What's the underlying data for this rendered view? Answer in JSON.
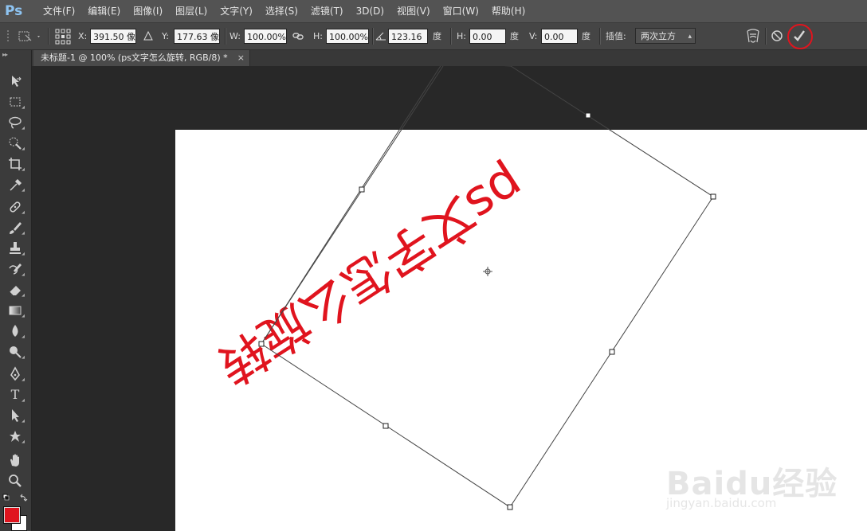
{
  "app": {
    "logo": "Ps"
  },
  "menu": [
    "文件(F)",
    "编辑(E)",
    "图像(I)",
    "图层(L)",
    "文字(Y)",
    "选择(S)",
    "滤镜(T)",
    "3D(D)",
    "视图(V)",
    "窗口(W)",
    "帮助(H)"
  ],
  "options": {
    "x_label": "X:",
    "x_value": "391.50 像",
    "y_label": "Y:",
    "y_value": "177.63 像",
    "w_label": "W:",
    "w_value": "100.00%",
    "h_label": "H:",
    "h_value": "100.00%",
    "angle_value": "123.16",
    "angle_unit": "度",
    "hskew_label": "H:",
    "hskew_value": "0.00",
    "hskew_unit": "度",
    "vskew_label": "V:",
    "vskew_value": "0.00",
    "vskew_unit": "度",
    "interp_label": "插值:",
    "interp_value": "两次立方"
  },
  "document": {
    "tab_title": "未标题-1 @ 100% (ps文字怎么旋转, RGB/8) *",
    "close_glyph": "×"
  },
  "canvas": {
    "text": "ps文字怎么旋转",
    "text_color": "#e0141e",
    "rotation_degrees": 123.16
  },
  "colors": {
    "foreground": "#e0141e",
    "background": "#ffffff",
    "confirm_highlight": "#e0141e"
  },
  "watermark": {
    "brand": "Baidu经验",
    "url": "jingyan.baidu.com"
  }
}
